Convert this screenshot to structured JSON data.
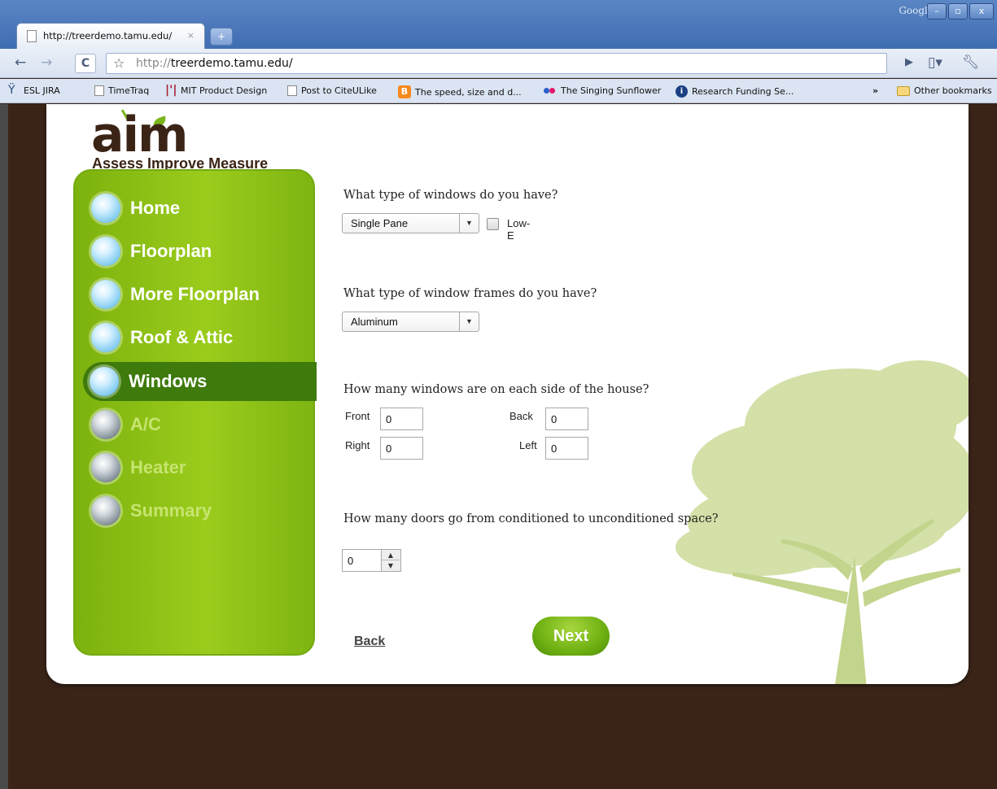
{
  "browser": {
    "tab_title": "http://treerdemo.tamu.edu/",
    "tab_close": "×",
    "new_tab": "+",
    "google_label": "Google",
    "url_scheme": "http://",
    "url_host": "treerdemo.tamu.edu/",
    "window_buttons": {
      "minimize": "–",
      "maximize": "▫",
      "close": "x"
    },
    "bookmarks": [
      {
        "label": "ESL JIRA",
        "icon": "person-icon"
      },
      {
        "label": "TimeTraq",
        "icon": "page-icon"
      },
      {
        "label": "MIT Product Design",
        "icon": "mit-icon"
      },
      {
        "label": "Post to CiteULike",
        "icon": "page-icon"
      },
      {
        "label": "The speed, size and d...",
        "icon": "blogger-icon"
      },
      {
        "label": "The Singing Sunflower",
        "icon": "flickr-icon"
      },
      {
        "label": "Research Funding Se...",
        "icon": "info-icon"
      }
    ],
    "overflow": "»",
    "other_bookmarks": "Other bookmarks"
  },
  "app": {
    "logo_text": "aim",
    "tagline": "Assess Improve Measure"
  },
  "nav": [
    {
      "label": "Home",
      "state": "done"
    },
    {
      "label": "Floorplan",
      "state": "done"
    },
    {
      "label": "More Floorplan",
      "state": "done"
    },
    {
      "label": "Roof & Attic",
      "state": "done"
    },
    {
      "label": "Windows",
      "state": "active"
    },
    {
      "label": "A/C",
      "state": "pending"
    },
    {
      "label": "Heater",
      "state": "pending"
    },
    {
      "label": "Summary",
      "state": "pending"
    }
  ],
  "form": {
    "q_window_type": "What type of windows do you have?",
    "window_type_value": "Single Pane",
    "low_e_label": "Low-E",
    "q_frames": "What type of window frames do you have?",
    "frames_value": "Aluminum",
    "q_sides": "How many windows are on each side of the house?",
    "front_label": "Front",
    "front_value": "0",
    "back_label": "Back",
    "back_value": "0",
    "right_label": "Right",
    "right_value": "0",
    "left_label": "Left",
    "left_value": "0",
    "q_doors": "How many doors go from conditioned to unconditioned space?",
    "doors_value": "0",
    "back_button": "Back",
    "next_button": "Next"
  },
  "colors": {
    "sidebar_green": "#8fc218",
    "active_green": "#3e7a0c",
    "brown_bg": "#3a2418",
    "tree_green": "#c9d99a"
  }
}
